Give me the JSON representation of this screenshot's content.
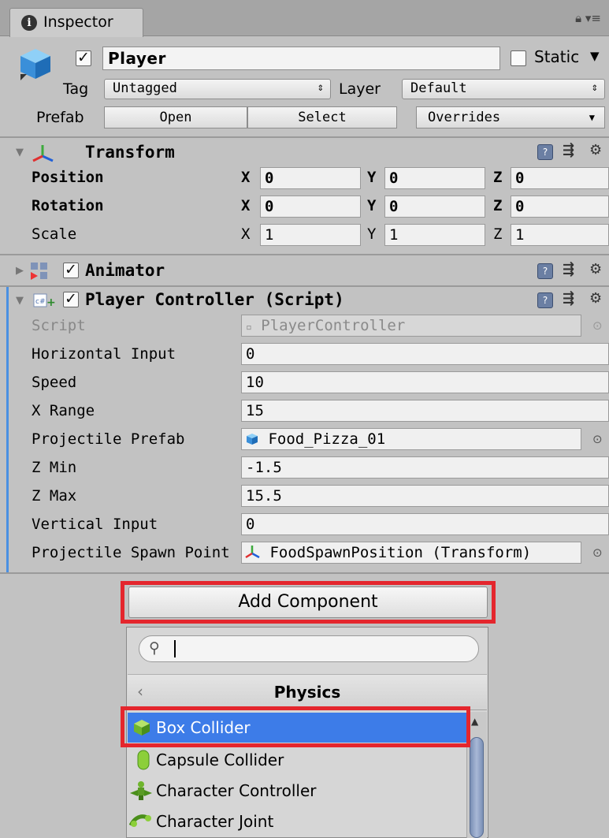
{
  "window": {
    "tab_label": "Inspector"
  },
  "header": {
    "object_name": "Player",
    "static_label": "Static",
    "tag_label": "Tag",
    "tag_value": "Untagged",
    "layer_label": "Layer",
    "layer_value": "Default",
    "prefab_label": "Prefab",
    "prefab_open": "Open",
    "prefab_select": "Select",
    "prefab_overrides": "Overrides"
  },
  "transform": {
    "title": "Transform",
    "rows": [
      {
        "label": "Position",
        "x": "0",
        "y": "0",
        "z": "0"
      },
      {
        "label": "Rotation",
        "x": "0",
        "y": "0",
        "z": "0"
      },
      {
        "label": "Scale",
        "x": "1",
        "y": "1",
        "z": "1"
      }
    ],
    "axis_labels": [
      "X",
      "Y",
      "Z"
    ]
  },
  "animator": {
    "title": "Animator"
  },
  "player_controller": {
    "title": "Player Controller (Script)",
    "fields": [
      {
        "label": "Script",
        "value": "PlayerController"
      },
      {
        "label": "Horizontal Input",
        "value": "0"
      },
      {
        "label": "Speed",
        "value": "10"
      },
      {
        "label": "X Range",
        "value": "15"
      },
      {
        "label": "Projectile Prefab",
        "value": "Food_Pizza_01"
      },
      {
        "label": "Z Min",
        "value": "-1.5"
      },
      {
        "label": "Z Max",
        "value": "15.5"
      },
      {
        "label": "Vertical Input",
        "value": "0"
      },
      {
        "label": "Projectile Spawn Point",
        "value": "FoodSpawnPosition (Transform)"
      }
    ]
  },
  "add_component": {
    "button_label": "Add Component",
    "search_value": "",
    "category": "Physics",
    "items": [
      {
        "label": "Box Collider",
        "icon": "box-collider-icon",
        "selected": true
      },
      {
        "label": "Capsule Collider",
        "icon": "capsule-collider-icon",
        "selected": false
      },
      {
        "label": "Character Controller",
        "icon": "character-controller-icon",
        "selected": false
      },
      {
        "label": "Character Joint",
        "icon": "character-joint-icon",
        "selected": false
      }
    ]
  },
  "colors": {
    "highlight_red": "#e4262d",
    "selection_blue": "#3d7ce8",
    "script_bar": "#4a90e2"
  }
}
